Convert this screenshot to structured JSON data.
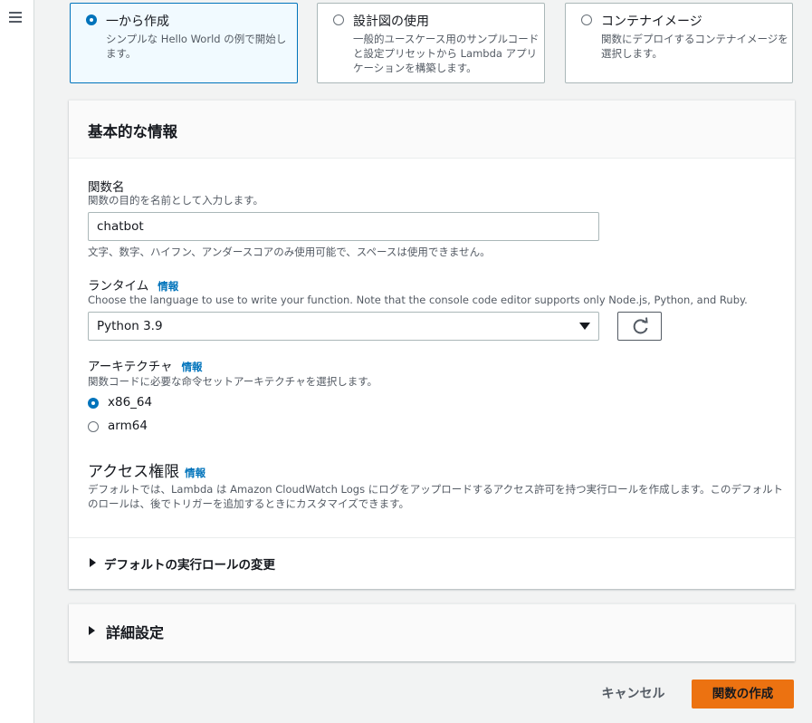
{
  "options": [
    {
      "title": "一から作成",
      "desc": "シンプルな Hello World の例で開始します。",
      "selected": true
    },
    {
      "title": "設計図の使用",
      "desc": "一般的ユースケース用のサンプルコードと設定プリセットから Lambda アプリケーションを構築します。",
      "selected": false
    },
    {
      "title": "コンテナイメージ",
      "desc": "関数にデプロイするコンテナイメージを選択します。",
      "selected": false
    }
  ],
  "basic_info": {
    "title": "基本的な情報",
    "function_name": {
      "label": "関数名",
      "desc": "関数の目的を名前として入力します。",
      "value": "chatbot",
      "constraint": "文字、数字、ハイフン、アンダースコアのみ使用可能で、スペースは使用できません。"
    },
    "runtime": {
      "label": "ランタイム",
      "info": "情報",
      "desc": "Choose the language to use to write your function. Note that the console code editor supports only Node.js, Python, and Ruby.",
      "value": "Python 3.9"
    },
    "architecture": {
      "label": "アーキテクチャ",
      "info": "情報",
      "desc": "関数コードに必要な命令セットアーキテクチャを選択します。",
      "options": [
        {
          "label": "x86_64",
          "selected": true
        },
        {
          "label": "arm64",
          "selected": false
        }
      ]
    },
    "permissions": {
      "label": "アクセス権限",
      "info": "情報",
      "desc": "デフォルトでは、Lambda は Amazon CloudWatch Logs にログをアップロードするアクセス許可を持つ実行ロールを作成します。このデフォルトのロールは、後でトリガーを追加するときにカスタマイズできます。"
    },
    "default_role": "デフォルトの実行ロールの変更"
  },
  "advanced": {
    "title": "詳細設定"
  },
  "footer": {
    "cancel": "キャンセル",
    "create": "関数の作成"
  },
  "colors": {
    "accent": "#0073bb",
    "primary_button": "#ec7211"
  }
}
